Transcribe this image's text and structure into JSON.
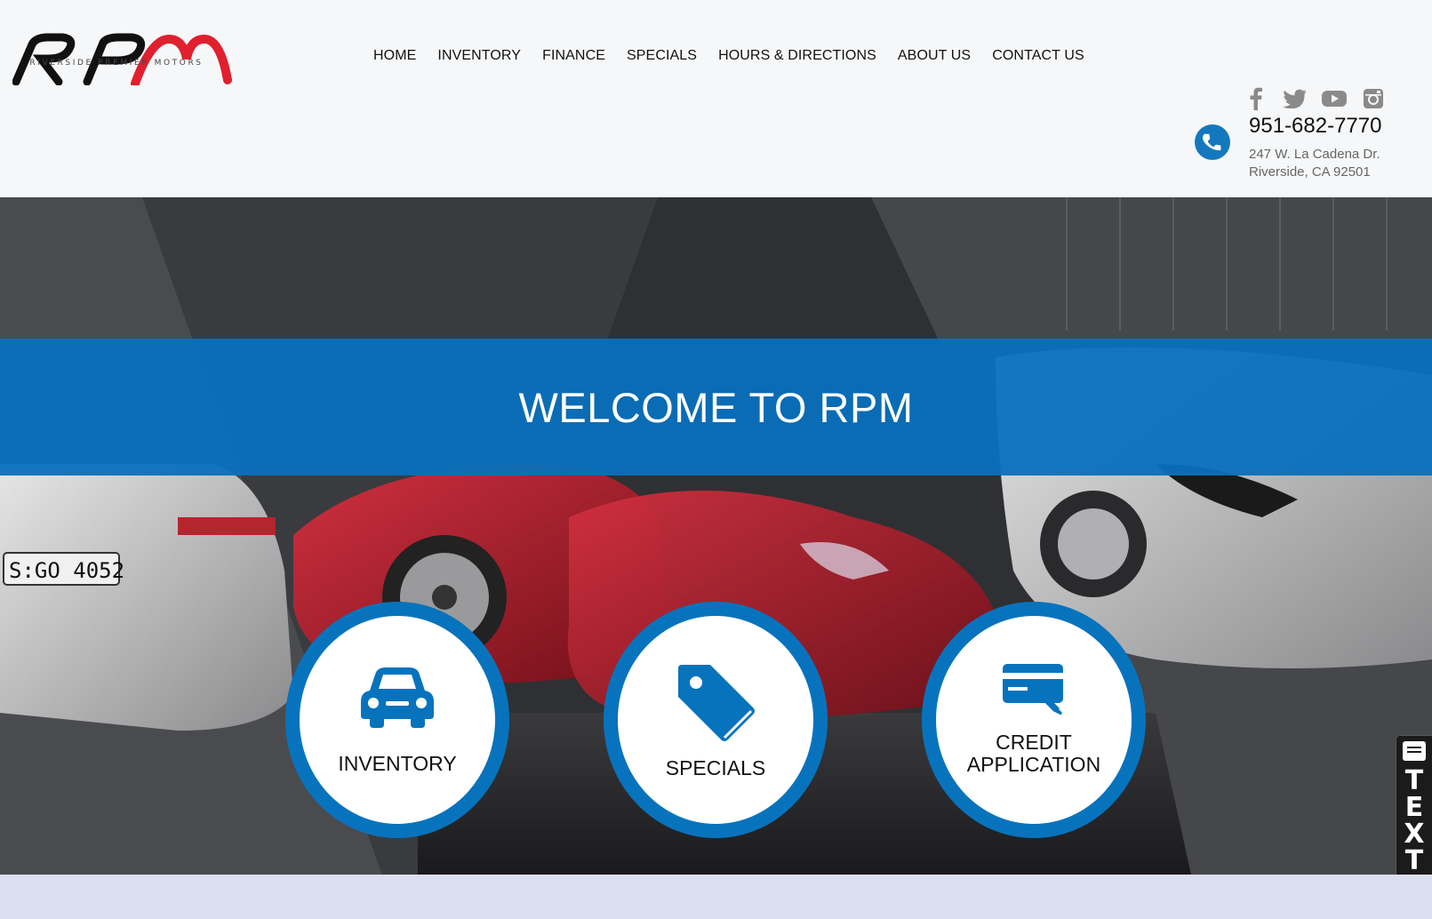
{
  "brand": {
    "logo_text": "RPM",
    "tagline": "RIVERSIDE PREMIER MOTORS"
  },
  "nav": {
    "items": [
      {
        "label": "HOME"
      },
      {
        "label": "INVENTORY"
      },
      {
        "label": "FINANCE"
      },
      {
        "label": "SPECIALS"
      },
      {
        "label": "HOURS & DIRECTIONS"
      },
      {
        "label": "ABOUT US"
      },
      {
        "label": "CONTACT US"
      }
    ]
  },
  "social": [
    "facebook-icon",
    "twitter-icon",
    "youtube-icon",
    "instagram-icon"
  ],
  "contact": {
    "phone": "951-682-7770",
    "address_line1": "247 W. La Cadena Dr.",
    "address_line2": "Riverside, CA 92501"
  },
  "hero": {
    "headline": "WELCOME TO RPM"
  },
  "tiles": [
    {
      "label": "INVENTORY",
      "icon": "car-icon"
    },
    {
      "label": "SPECIALS",
      "icon": "price-tag-icon"
    },
    {
      "label_line1": "CREDIT",
      "label_line2": "APPLICATION",
      "icon": "credit-card-icon"
    }
  ],
  "text_widget": {
    "label": "TEXT"
  },
  "colors": {
    "accent": "#0873bd",
    "logo_red": "#e0202e",
    "logo_black": "#111111"
  }
}
